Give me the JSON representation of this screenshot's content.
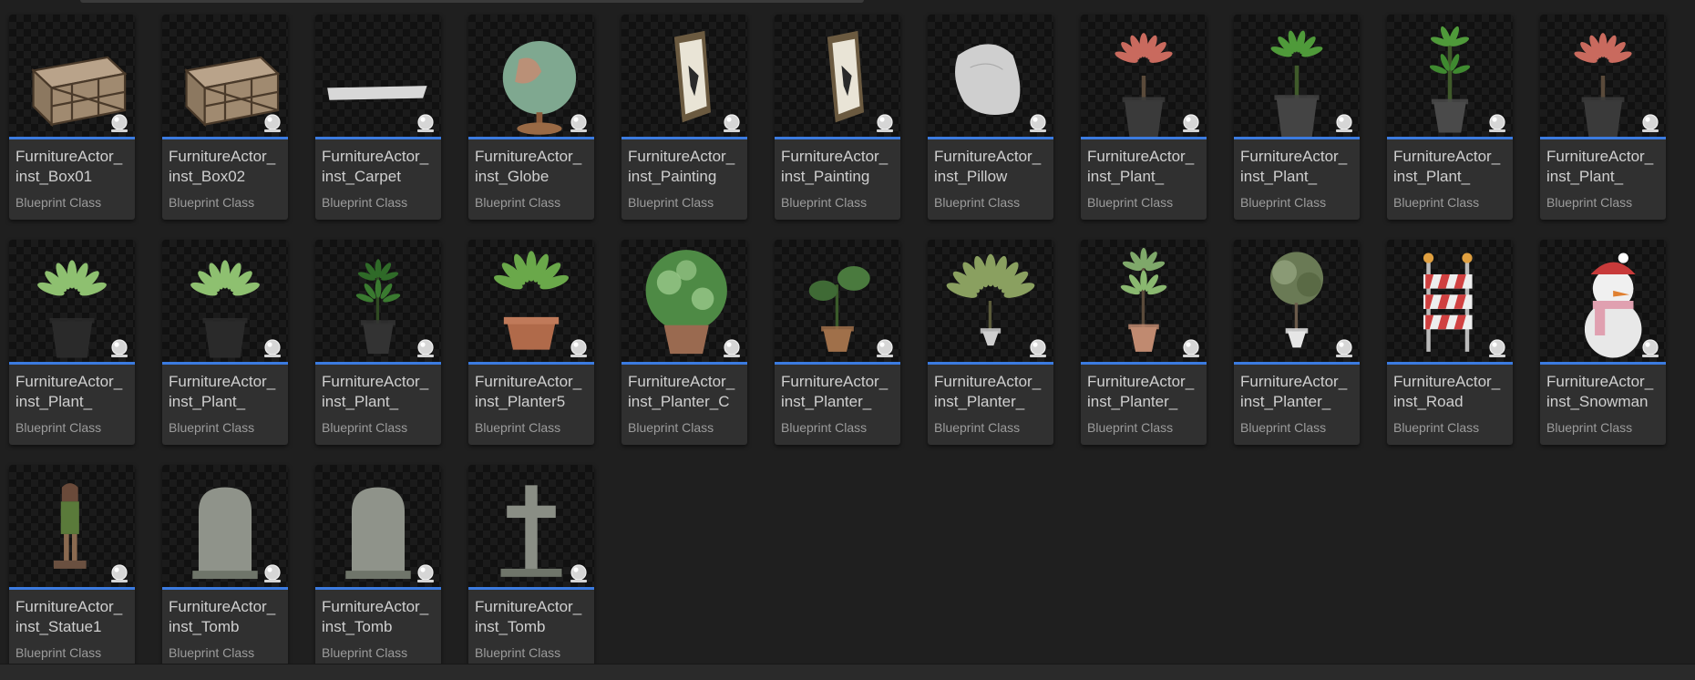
{
  "assets": [
    {
      "name": "FurnitureActor_\ninst_Box01",
      "type": "Blueprint Class",
      "icon": "crate-icon"
    },
    {
      "name": "FurnitureActor_\ninst_Box02",
      "type": "Blueprint Class",
      "icon": "crate-icon"
    },
    {
      "name": "FurnitureActor_\ninst_Carpet",
      "type": "Blueprint Class",
      "icon": "carpet-icon"
    },
    {
      "name": "FurnitureActor_\ninst_Globe",
      "type": "Blueprint Class",
      "icon": "globe-icon"
    },
    {
      "name": "FurnitureActor_\ninst_Painting",
      "type": "Blueprint Class",
      "icon": "painting-icon"
    },
    {
      "name": "FurnitureActor_\ninst_Painting",
      "type": "Blueprint Class",
      "icon": "painting-icon"
    },
    {
      "name": "FurnitureActor_\ninst_Pillow",
      "type": "Blueprint Class",
      "icon": "pillow-icon"
    },
    {
      "name": "FurnitureActor_\ninst_Plant_",
      "type": "Blueprint Class",
      "icon": "red-plant-icon"
    },
    {
      "name": "FurnitureActor_\ninst_Plant_",
      "type": "Blueprint Class",
      "icon": "green-plant-icon"
    },
    {
      "name": "FurnitureActor_\ninst_Plant_",
      "type": "Blueprint Class",
      "icon": "tall-plant-icon"
    },
    {
      "name": "FurnitureActor_\ninst_Plant_",
      "type": "Blueprint Class",
      "icon": "red-plant-icon"
    },
    {
      "name": "FurnitureActor_\ninst_Plant_",
      "type": "Blueprint Class",
      "icon": "leafy-plant-icon"
    },
    {
      "name": "FurnitureActor_\ninst_Plant_",
      "type": "Blueprint Class",
      "icon": "leafy-plant-icon"
    },
    {
      "name": "FurnitureActor_\ninst_Plant_",
      "type": "Blueprint Class",
      "icon": "bush-plant-icon"
    },
    {
      "name": "FurnitureActor_\ninst_Planter5",
      "type": "Blueprint Class",
      "icon": "planter-icon"
    },
    {
      "name": "FurnitureActor_\ninst_Planter_C",
      "type": "Blueprint Class",
      "icon": "round-planter-icon"
    },
    {
      "name": "FurnitureActor_\ninst_Planter_",
      "type": "Blueprint Class",
      "icon": "monstera-planter-icon"
    },
    {
      "name": "FurnitureActor_\ninst_Planter_",
      "type": "Blueprint Class",
      "icon": "palm-planter-icon"
    },
    {
      "name": "FurnitureActor_\ninst_Planter_",
      "type": "Blueprint Class",
      "icon": "ficus-planter-icon"
    },
    {
      "name": "FurnitureActor_\ninst_Planter_",
      "type": "Blueprint Class",
      "icon": "tree-planter-icon"
    },
    {
      "name": "FurnitureActor_\ninst_Road",
      "type": "Blueprint Class",
      "icon": "road-barrier-icon"
    },
    {
      "name": "FurnitureActor_\ninst_Snowman",
      "type": "Blueprint Class",
      "icon": "snowman-icon"
    },
    {
      "name": "FurnitureActor_\ninst_Statue1",
      "type": "Blueprint Class",
      "icon": "statue-icon"
    },
    {
      "name": "FurnitureActor_\ninst_Tomb",
      "type": "Blueprint Class",
      "icon": "tombstone-icon"
    },
    {
      "name": "FurnitureActor_\ninst_Tomb",
      "type": "Blueprint Class",
      "icon": "tombstone-icon"
    },
    {
      "name": "FurnitureActor_\ninst_Tomb",
      "type": "Blueprint Class",
      "icon": "cross-tomb-icon"
    }
  ],
  "colors": {
    "background": "#1f1f1f",
    "tile": "#303030",
    "accent": "#3b7be0",
    "name_text": "#cfcfcf",
    "type_text": "#9c9c9c"
  }
}
